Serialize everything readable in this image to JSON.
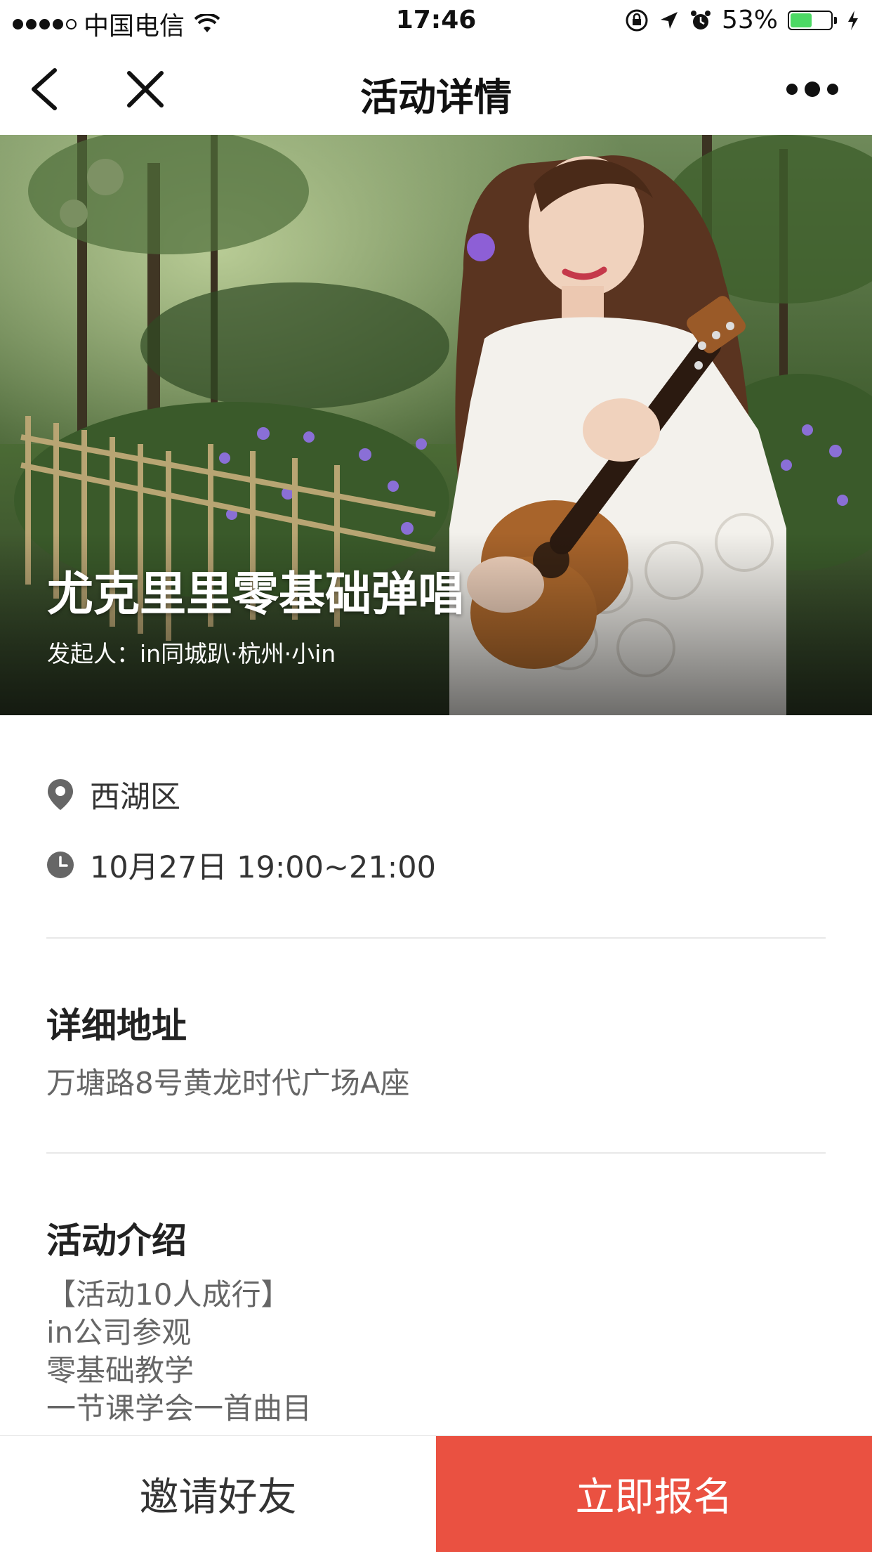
{
  "status_bar": {
    "carrier": "中国电信",
    "time": "17:46",
    "battery_percent_label": "53%",
    "battery_level": 0.53
  },
  "nav": {
    "title": "活动详情"
  },
  "hero": {
    "title": "尤克里里零基础弹唱",
    "organizer": "发起人：in同城趴·杭州·小in"
  },
  "info": {
    "location": "西湖区",
    "datetime": "10月27日 19:00~21:00"
  },
  "address": {
    "heading": "详细地址",
    "text": "万塘路8号黄龙时代广场A座"
  },
  "intro": {
    "heading": "活动介绍",
    "lines": [
      "【活动10人成行】",
      "in公司参观",
      "零基础教学",
      "一节课学会一首曲目"
    ]
  },
  "actions": {
    "invite_label": "邀请好友",
    "signup_label": "立即报名"
  },
  "colors": {
    "accent": "#ea5141",
    "battery": "#4cd964"
  }
}
